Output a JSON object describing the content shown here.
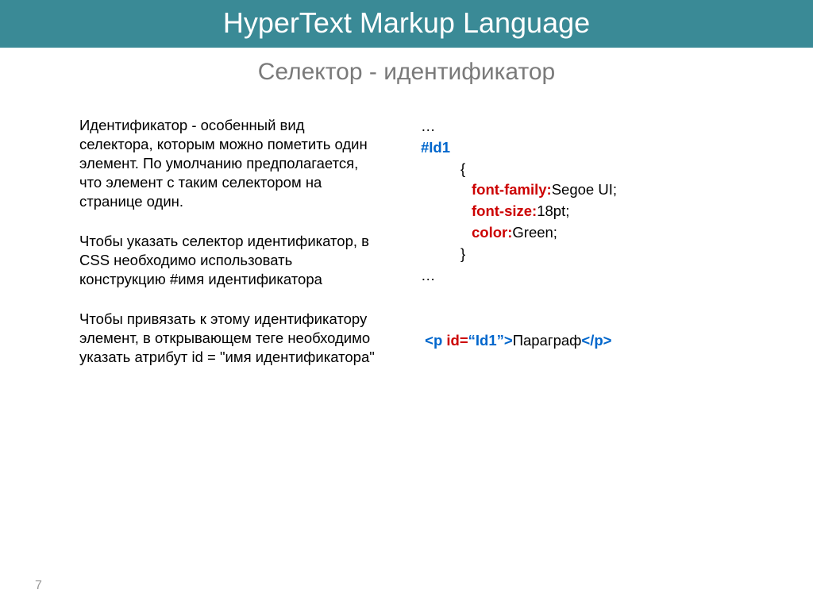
{
  "header": {
    "title": "HyperText Markup Language"
  },
  "subtitle": "Селектор - идентификатор",
  "left": {
    "p1": "Идентификатор - особенный вид селектора, которым можно пометить один элемент. По умолчанию предполагается, что элемент с таким селектором на странице один.",
    "p2": "Чтобы указать селектор идентификатор, в CSS необходимо использовать конструкцию #имя идентификатора",
    "p3": "Чтобы привязать к этому идентификатору элемент, в открывающем теге необходимо указать атрибут id = \"имя идентификатора\""
  },
  "code": {
    "ellipsis1": "…",
    "selector": "#Id1",
    "brace_open": "{",
    "decl1_prop": "font-family:",
    "decl1_val": "Segoe UI;",
    "decl2_prop": "font-size:",
    "decl2_val": "18pt;",
    "decl3_prop": "color:",
    "decl3_val": "Green;",
    "brace_close": "}",
    "ellipsis2": "…",
    "html_open_tag": "<p ",
    "html_attr": "id=",
    "html_attr_val": "“Id1”",
    "html_open_end": ">",
    "html_text": "Параграф",
    "html_close": "</p>"
  },
  "page_number": "7"
}
